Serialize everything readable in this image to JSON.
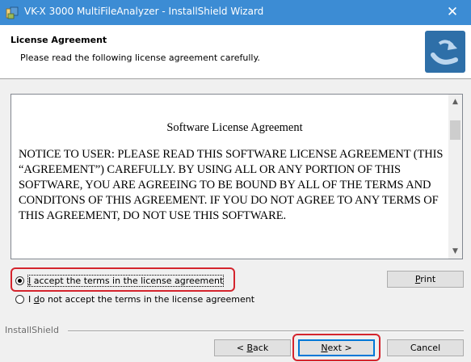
{
  "window": {
    "title": "VK-X 3000 MultiFileAnalyzer - InstallShield Wizard",
    "close_glyph": "✕",
    "app_icon": "installer-icon"
  },
  "header": {
    "title": "License Agreement",
    "subtitle": "Please read the following license agreement carefully.",
    "logo_icon": "installshield-logo-icon"
  },
  "license": {
    "title": "Software License Agreement",
    "body": "NOTICE TO USER: PLEASE READ THIS SOFTWARE LICENSE AGREEMENT (THIS “AGREEMENT”) CAREFULLY. BY USING ALL OR ANY PORTION OF THIS SOFTWARE, YOU ARE AGREEING TO BE BOUND BY ALL OF THE TERMS AND CONDITONS OF THIS AGREEMENT. IF YOU DO NOT AGREE TO ANY TERMS OF THIS AGREEMENT, DO NOT USE THIS SOFTWARE.",
    "scroll_up_glyph": "▲",
    "scroll_down_glyph": "▼"
  },
  "options": {
    "accept": {
      "pre": "",
      "key": "I",
      "post": " accept the terms in the license agreement",
      "selected": true
    },
    "decline": {
      "pre": "I ",
      "key": "d",
      "post": "o not accept the terms in the license agreement",
      "selected": false
    }
  },
  "buttons": {
    "print": {
      "key": "P",
      "rest": "rint"
    },
    "back": {
      "pre": "< ",
      "key": "B",
      "rest": "ack"
    },
    "next": {
      "key": "N",
      "rest": "ext >"
    },
    "cancel": {
      "label": "Cancel"
    }
  },
  "footer": {
    "group_label": "InstallShield"
  },
  "colors": {
    "titlebar": "#3c8cd4",
    "highlight": "#d4242d",
    "default_button_border": "#0078d7"
  }
}
